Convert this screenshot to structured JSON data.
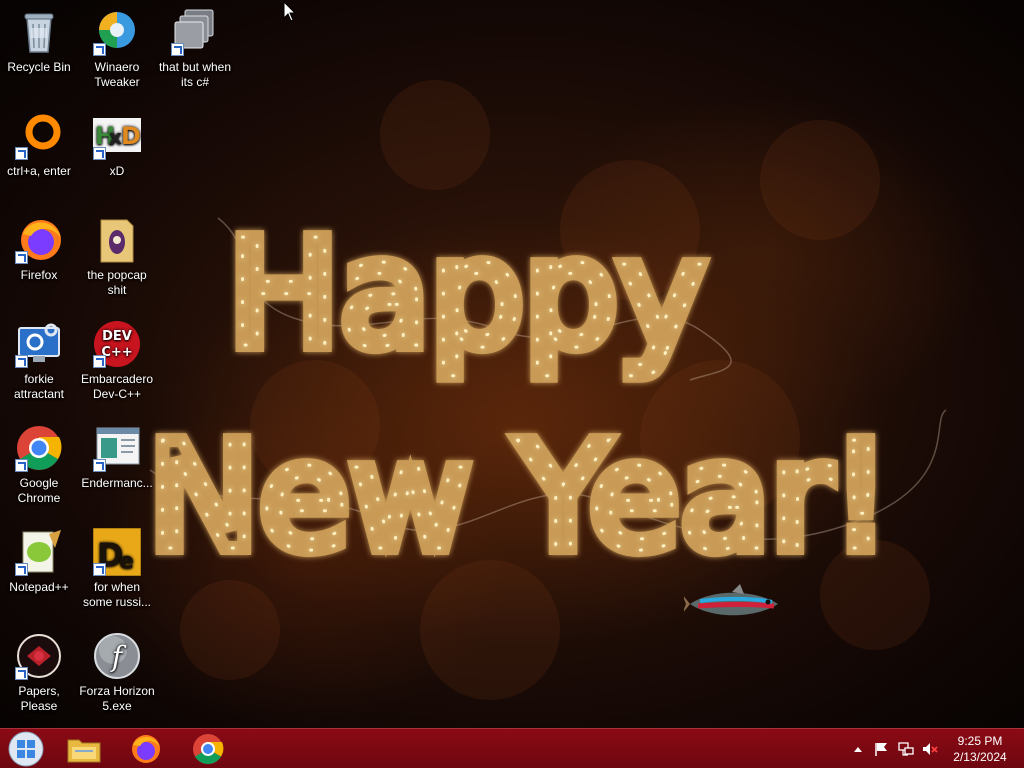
{
  "wallpaper": {
    "line1": "Happy",
    "line2": "New Year!"
  },
  "desktop_icons": [
    {
      "label": "Recycle Bin",
      "icon": "recycle-bin-icon"
    },
    {
      "label": "Winaero Tweaker",
      "icon": "winaero-tweaker-icon"
    },
    {
      "label": "that but when its c#",
      "icon": "shortcut-stack-icon"
    },
    {
      "label": "ctrl+a, enter",
      "icon": "orange-ring-icon"
    },
    {
      "label": "xD",
      "icon": "hxd-icon"
    },
    {
      "label": "Firefox",
      "icon": "firefox-icon"
    },
    {
      "label": "the popcap shit",
      "icon": "folder-icon"
    },
    {
      "label": "forkie attractant",
      "icon": "monitor-gear-icon"
    },
    {
      "label": "Embarcadero Dev-C++",
      "icon": "devcpp-icon"
    },
    {
      "label": "Google Chrome",
      "icon": "chrome-icon"
    },
    {
      "label": "Endermanc...",
      "icon": "window-app-icon"
    },
    {
      "label": "Notepad++",
      "icon": "notepadpp-icon"
    },
    {
      "label": "for when some russi...",
      "icon": "de-icon"
    },
    {
      "label": "Papers, Please",
      "icon": "papers-please-icon"
    },
    {
      "label": "Forza Horizon 5.exe",
      "icon": "flash-icon"
    }
  ],
  "taskbar": {
    "start": "start-button-icon",
    "pinned": [
      {
        "name": "File Explorer",
        "icon": "file-explorer-icon"
      },
      {
        "name": "Firefox",
        "icon": "firefox-icon"
      },
      {
        "name": "Google Chrome",
        "icon": "chrome-icon"
      }
    ],
    "tray": {
      "time": "9:25 PM",
      "date": "2/13/2024"
    }
  },
  "colors": {
    "taskbar": "#7c0811",
    "glow": "#ffd98a"
  }
}
